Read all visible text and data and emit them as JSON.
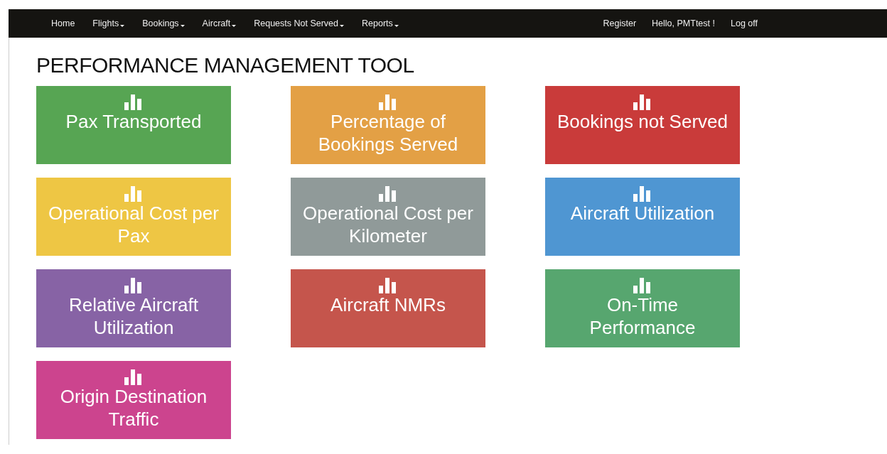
{
  "navbar": {
    "left_items": [
      {
        "label": "Home",
        "dropdown": false
      },
      {
        "label": "Flights",
        "dropdown": true
      },
      {
        "label": "Bookings",
        "dropdown": true
      },
      {
        "label": "Aircraft",
        "dropdown": true
      },
      {
        "label": "Requests Not Served",
        "dropdown": true
      },
      {
        "label": "Reports",
        "dropdown": true
      }
    ],
    "right_items": [
      {
        "label": "Register"
      },
      {
        "label": "Hello, PMTtest !"
      },
      {
        "label": "Log off"
      }
    ]
  },
  "page_title": "PERFORMANCE MANAGEMENT TOOL",
  "tiles": [
    {
      "label": "Pax Transported",
      "color": "#57a553"
    },
    {
      "label": "Percentage of Bookings Served",
      "color": "#e3a045"
    },
    {
      "label": "Bookings not Served",
      "color": "#c93b3a"
    },
    {
      "label": "Operational Cost per Pax",
      "color": "#eec644"
    },
    {
      "label": "Operational Cost per Kilometer",
      "color": "#909a99"
    },
    {
      "label": "Aircraft Utilization",
      "color": "#4f96d2"
    },
    {
      "label": "Relative Aircraft Utilization",
      "color": "#8763a5"
    },
    {
      "label": "Aircraft NMRs",
      "color": "#c5554c"
    },
    {
      "label": "On-Time Performance",
      "color": "#57a66f"
    },
    {
      "label": "Origin Destination Traffic",
      "color": "#cc448e"
    }
  ]
}
